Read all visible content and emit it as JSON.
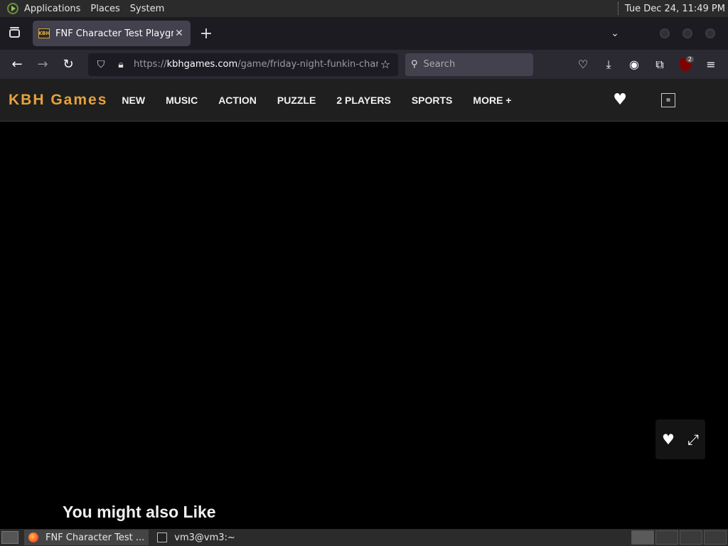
{
  "top_panel": {
    "menus": [
      "Applications",
      "Places",
      "System"
    ],
    "clock": "Tue Dec 24, 11:49 PM"
  },
  "browser": {
    "tab": {
      "title": "FNF Character Test Playgro",
      "favicon_text": "KBH"
    },
    "url": {
      "scheme": "https://",
      "host": "kbhgames.com",
      "path": "/game/friday-night-funkin-char"
    },
    "search_placeholder": "Search",
    "ublock_badge": "2"
  },
  "site": {
    "logo": "KBH Games",
    "nav": [
      "NEW",
      "MUSIC",
      "ACTION",
      "PUZZLE",
      "2 PLAYERS",
      "SPORTS",
      "MORE +"
    ],
    "qr_text": "▦"
  },
  "page": {
    "might_like": "You might also Like"
  },
  "taskbar": {
    "tasks": [
      "FNF Character Test ...",
      "vm3@vm3:~"
    ]
  }
}
